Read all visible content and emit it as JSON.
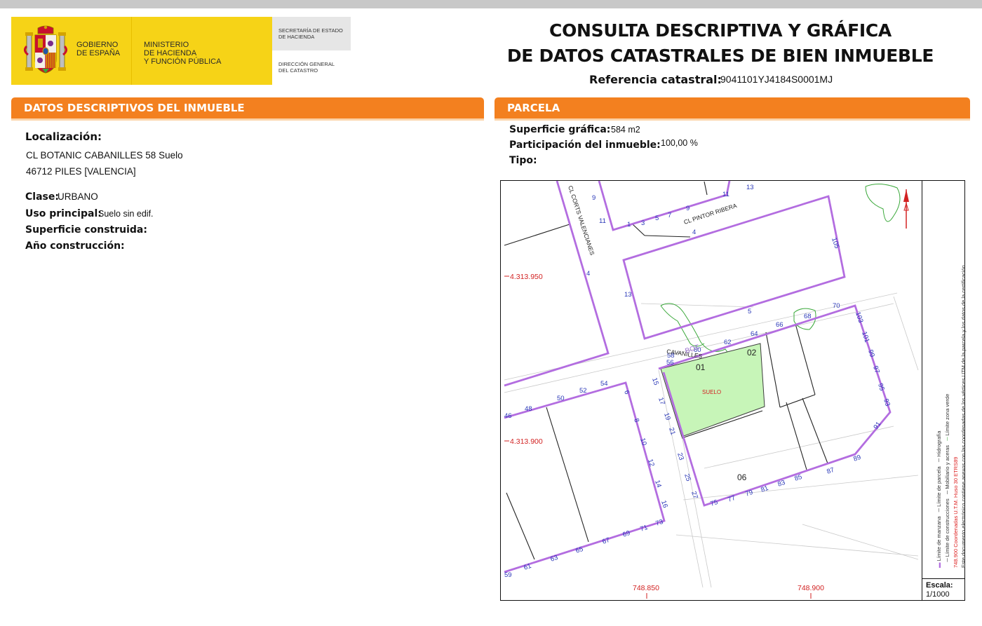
{
  "header": {
    "gobierno": [
      "GOBIERNO",
      "DE ESPAÑA"
    ],
    "ministerio": [
      "MINISTERIO",
      "DE HACIENDA",
      "Y FUNCIÓN PÚBLICA"
    ],
    "secretaria": [
      "SECRETARÍA DE ESTADO",
      "DE HACIENDA"
    ],
    "direccion": [
      "DIRECCIÓN GENERAL",
      "DEL CATASTRO"
    ],
    "title_line1": "CONSULTA DESCRIPTIVA Y GRÁFICA",
    "title_line2": "DE DATOS CATASTRALES DE BIEN INMUEBLE",
    "ref_label": "Referencia catastral:",
    "ref_value": "9041101YJ4184S0001MJ"
  },
  "left_section": {
    "title_prefix": "DATOS DESCRIPTIVOS DEL ",
    "title_bold": "INMUEBLE",
    "localizacion_label": "Localización:",
    "address_line1": "CL BOTANIC CABANILLES 58 Suelo",
    "address_line2": "46712 PILES [VALENCIA]",
    "clase_label": "Clase:",
    "clase_value": "URBANO",
    "uso_label": "Uso principal:",
    "uso_value": "Suelo sin edif.",
    "superficie_label": "Superficie construida:",
    "anio_label": "Año construcción:"
  },
  "right_section": {
    "title": "PARCELA",
    "sup_grafica_label": "Superficie gráfica:",
    "sup_grafica_value": "584 m2",
    "participacion_label": "Participación del inmueble:",
    "participacion_value": "100,00 %",
    "tipo_label": "Tipo:"
  },
  "map": {
    "streets": {
      "corts": "CL CORTS VALENCIANES",
      "pintor": "CL PINTOR RIBERA",
      "cavanilles": "CAVANILLES",
      "cavanilles_num": "BOT"
    },
    "coords": {
      "y1": "4.313.950",
      "y2": "4.313.900",
      "x1": "748.850",
      "x2": "748.900"
    },
    "parcel_labels": {
      "p01": "01",
      "p02": "02",
      "p06": "06",
      "suelo": "SUELO"
    },
    "house_numbers": {
      "top": [
        "9",
        "11",
        "1",
        "3",
        "5",
        "7",
        "9",
        "11",
        "13",
        "4",
        "105"
      ],
      "mid": [
        "4",
        "13",
        "5",
        "70",
        "68",
        "66",
        "64",
        "62",
        "60",
        "58",
        "56",
        "103",
        "101",
        "99",
        "97",
        "95",
        "93",
        "91",
        "89",
        "87"
      ],
      "left": [
        "46",
        "48",
        "50",
        "52",
        "54",
        "6",
        "8",
        "10",
        "12",
        "14",
        "16",
        "15",
        "17",
        "19",
        "21",
        "23",
        "25",
        "27"
      ],
      "bottom": [
        "75",
        "77",
        "79",
        "81",
        "83",
        "85",
        "73",
        "71",
        "69",
        "67",
        "65",
        "63",
        "61",
        "59"
      ]
    },
    "legend": {
      "limite_manzana": "Límite de manzana",
      "limite_parcela": "Límite de parcela",
      "hidrografia": "Hidrografía",
      "limite_construcciones": "Límite de construcciones",
      "mobiliario": "Mobiliario y aceras",
      "zona_verde": "Límite zona verde",
      "coord_note": "748.900 Coordenadas U.T.M. Huso 30 ETRS89",
      "doc_note": "Este documento electrónico contiene anexos con las coordenadas de los vértices UTM de la parcela y los datos de la certificación."
    },
    "scale_label": "Escala:",
    "scale_value": "1/1000"
  },
  "colors": {
    "orange": "#f3801f",
    "yellow": "#f6d317",
    "purple": "#b36de0",
    "blue_numbers": "#2a38b8",
    "red_coords": "#d22222",
    "green": "#3aa83a",
    "parcel_fill": "#c7f5b8"
  }
}
